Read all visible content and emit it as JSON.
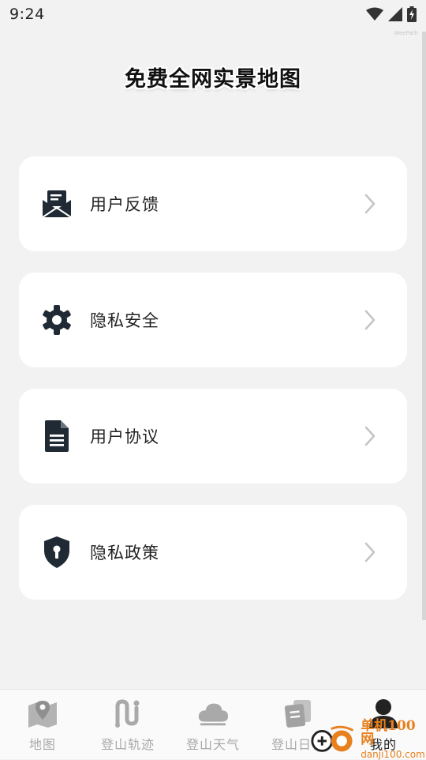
{
  "status_bar": {
    "time": "9:24"
  },
  "watermark": "WeePath",
  "title": "免费全网实景地图",
  "menu": [
    {
      "label": "用户反馈",
      "icon": "mail-open-icon"
    },
    {
      "label": "隐私安全",
      "icon": "gear-icon"
    },
    {
      "label": "用户协议",
      "icon": "document-icon"
    },
    {
      "label": "隐私政策",
      "icon": "shield-lock-icon"
    }
  ],
  "bottom_nav": {
    "active_index": 4,
    "items": [
      {
        "label": "地图",
        "icon": "map-pin-icon"
      },
      {
        "label": "登山轨迹",
        "icon": "trail-icon"
      },
      {
        "label": "登山天气",
        "icon": "cloud-icon"
      },
      {
        "label": "登山日记",
        "icon": "notebook-icon"
      },
      {
        "label": "我的",
        "icon": "user-icon"
      }
    ]
  },
  "site_badge": {
    "cn": "单机100网",
    "en": "danji100.com"
  },
  "colors": {
    "background": "#f2f2f2",
    "card": "#ffffff",
    "icon_dark": "#1f2a35",
    "nav_inactive": "#a9a9a9",
    "badge_orange": "#e8801e"
  }
}
